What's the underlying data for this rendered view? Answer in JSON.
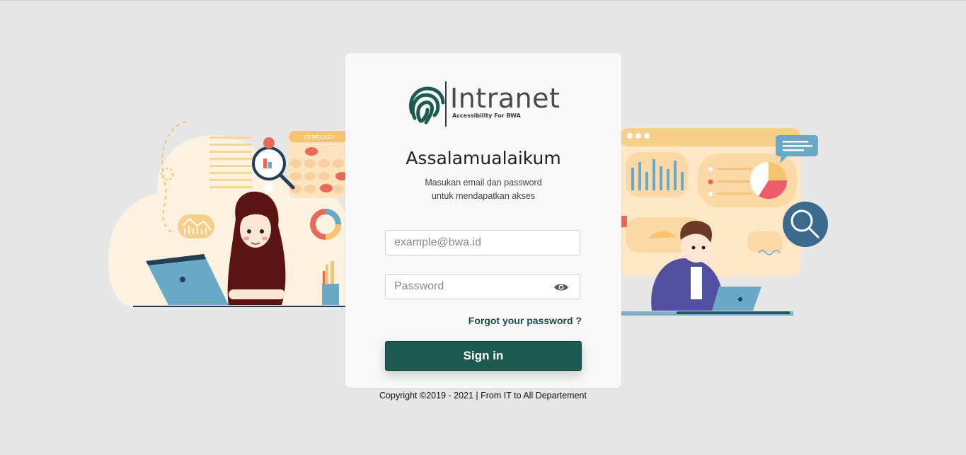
{
  "logo": {
    "word": "Intranet",
    "tagline": "Accessibility For BWA",
    "icon": "fingerprint-icon"
  },
  "greeting": "Assalamualaikum",
  "subtitle": {
    "line1": "Masukan email dan password",
    "line2": "untuk mendapatkan akses"
  },
  "form": {
    "email_placeholder": "example@bwa.id",
    "email_value": "",
    "password_placeholder": "Password",
    "password_value": "",
    "password_toggle_icon": "eye-icon",
    "forgot_label": "Forgot your password ?",
    "signin_label": "Sign in"
  },
  "illustration_left": {
    "calendar_label": "FEBRUARY"
  },
  "footer": {
    "copyright": "Copyright ©2019 - 2021 | From IT to All Departement"
  },
  "colors": {
    "accent": "#1d5a50",
    "background": "#e6e6e6",
    "card": "#f8f8f8"
  }
}
